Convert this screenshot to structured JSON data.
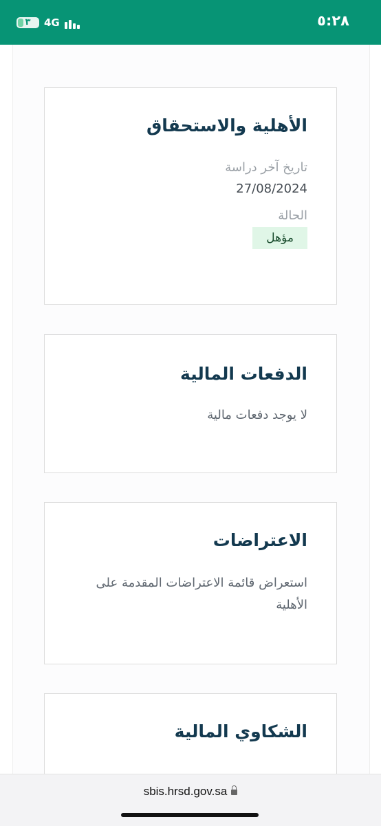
{
  "status_bar": {
    "time": "٥:٢٨",
    "battery": "٣",
    "network": "4G"
  },
  "cards": {
    "eligibility": {
      "title": "الأهلية والاستحقاق",
      "last_study_label": "تاريخ آخر دراسة",
      "last_study_date": "27/08/2024",
      "status_label": "الحالة",
      "status_value": "مؤهل"
    },
    "payments": {
      "title": "الدفعات المالية",
      "description": "لا يوجد دفعات مالية"
    },
    "objections": {
      "title": "الاعتراضات",
      "description": "استعراض قائمة الاعتراضات المقدمة على الأهلية"
    },
    "complaints": {
      "title": "الشكاوي المالية"
    }
  },
  "browser": {
    "url": "sbis.hrsd.gov.sa"
  },
  "colors": {
    "status_bar": "#079475",
    "title": "#13394f",
    "badge_bg": "#e0f6e7"
  }
}
